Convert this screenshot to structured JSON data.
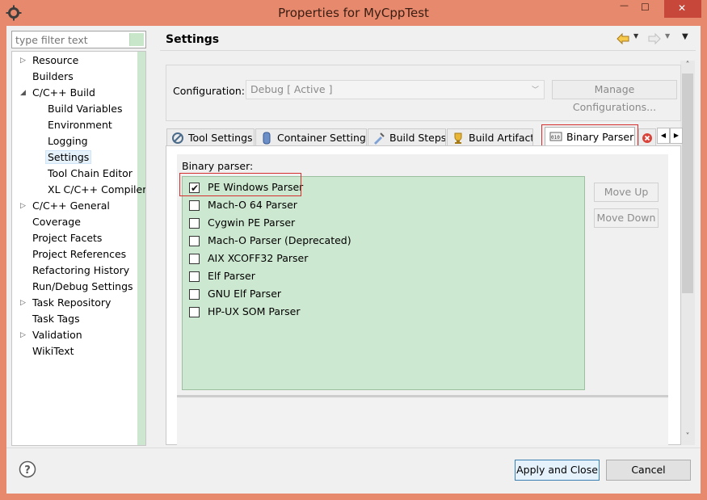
{
  "window": {
    "title": "Properties for MyCppTest",
    "minimize": "—",
    "maximize": "☐",
    "close": "✕"
  },
  "nav": {
    "filter_placeholder": "type filter text",
    "items": [
      {
        "label": "Resource",
        "arrow": "▷"
      },
      {
        "label": "Builders",
        "arrow": ""
      },
      {
        "label": "C/C++ Build",
        "arrow": "◢"
      },
      {
        "label": "Build Variables",
        "arrow": ""
      },
      {
        "label": "Environment",
        "arrow": ""
      },
      {
        "label": "Logging",
        "arrow": ""
      },
      {
        "label": "Settings",
        "arrow": ""
      },
      {
        "label": "Tool Chain Editor",
        "arrow": ""
      },
      {
        "label": "XL C/C++ Compiler",
        "arrow": ""
      },
      {
        "label": "C/C++ General",
        "arrow": "▷"
      },
      {
        "label": "Coverage",
        "arrow": ""
      },
      {
        "label": "Project Facets",
        "arrow": ""
      },
      {
        "label": "Project References",
        "arrow": ""
      },
      {
        "label": "Refactoring History",
        "arrow": ""
      },
      {
        "label": "Run/Debug Settings",
        "arrow": ""
      },
      {
        "label": "Task Repository",
        "arrow": "▷"
      },
      {
        "label": "Task Tags",
        "arrow": ""
      },
      {
        "label": "Validation",
        "arrow": "▷"
      },
      {
        "label": "WikiText",
        "arrow": ""
      }
    ]
  },
  "page": {
    "title": "Settings"
  },
  "config": {
    "label": "Configuration:",
    "value": "Debug  [ Active ]",
    "manage_label": "Manage Configurations..."
  },
  "tabs": [
    {
      "label": "Tool Settings",
      "icon": "tool-settings-icon"
    },
    {
      "label": "Container Settings",
      "icon": "container-icon"
    },
    {
      "label": "Build Steps",
      "icon": "build-steps-icon"
    },
    {
      "label": "Build Artifact",
      "icon": "trophy-icon"
    },
    {
      "label": "Binary Parsers",
      "icon": "binary-icon",
      "active": true
    },
    {
      "label": "",
      "icon": "error-icon"
    }
  ],
  "binary": {
    "label": "Binary parser:",
    "parsers": [
      {
        "name": "PE Windows Parser",
        "checked": "✔"
      },
      {
        "name": "Mach-O 64 Parser",
        "checked": ""
      },
      {
        "name": "Cygwin PE Parser",
        "checked": ""
      },
      {
        "name": "Mach-O Parser (Deprecated)",
        "checked": ""
      },
      {
        "name": "AIX XCOFF32 Parser",
        "checked": ""
      },
      {
        "name": "Elf Parser",
        "checked": ""
      },
      {
        "name": "GNU Elf Parser",
        "checked": ""
      },
      {
        "name": "HP-UX SOM Parser",
        "checked": ""
      }
    ],
    "move_up": "Move Up",
    "move_down": "Move Down"
  },
  "footer": {
    "apply_label": "Apply and Close",
    "cancel_label": "Cancel"
  },
  "colors": {
    "titlebar": "#e6896d",
    "close_button": "#c7483b",
    "parser_list_bg": "#cde8d0",
    "highlight_border": "#d62f2f"
  }
}
